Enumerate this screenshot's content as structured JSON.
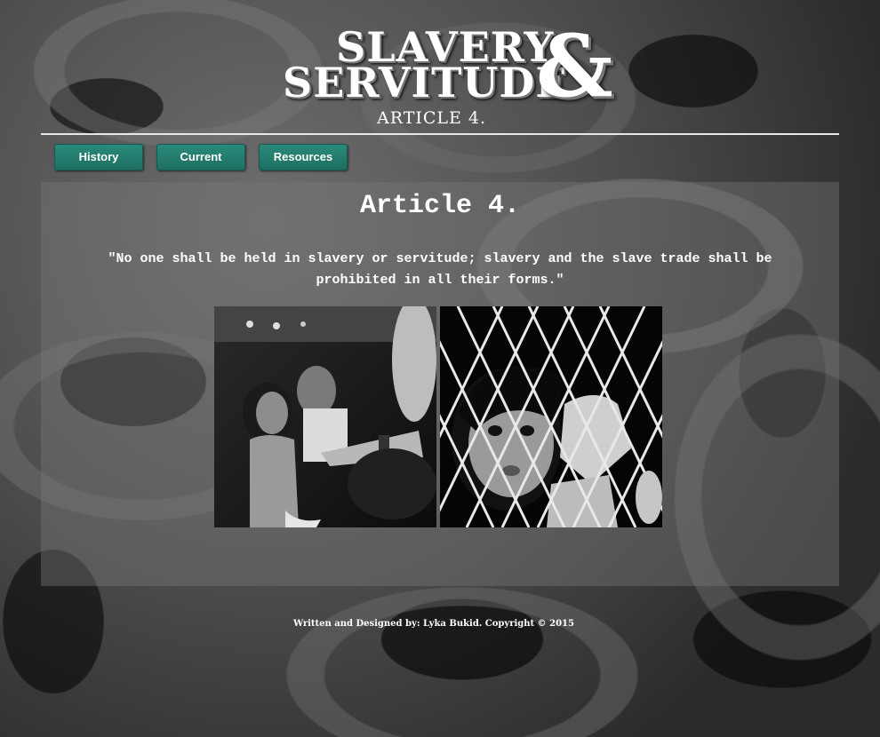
{
  "header": {
    "logo_line1": "SLAVERY",
    "logo_line2": "SERVITUDE",
    "logo_amp": "&",
    "logo_subtitle": "ARTICLE 4."
  },
  "nav": {
    "items": [
      {
        "label": "History"
      },
      {
        "label": "Current"
      },
      {
        "label": "Resources"
      }
    ],
    "button_color": "#1f7a6c"
  },
  "main": {
    "title": "Article 4.",
    "quote": "\"No one shall be held in slavery or servitude; slavery and the slave trade shall be prohibited in all their forms.\"",
    "images": [
      {
        "subject": "woman-held-by-arm-photo"
      },
      {
        "subject": "child-behind-net-photo"
      }
    ]
  },
  "footer": {
    "text": "Written and Designed by: Lyka Bukid. Copyright © 2015"
  }
}
